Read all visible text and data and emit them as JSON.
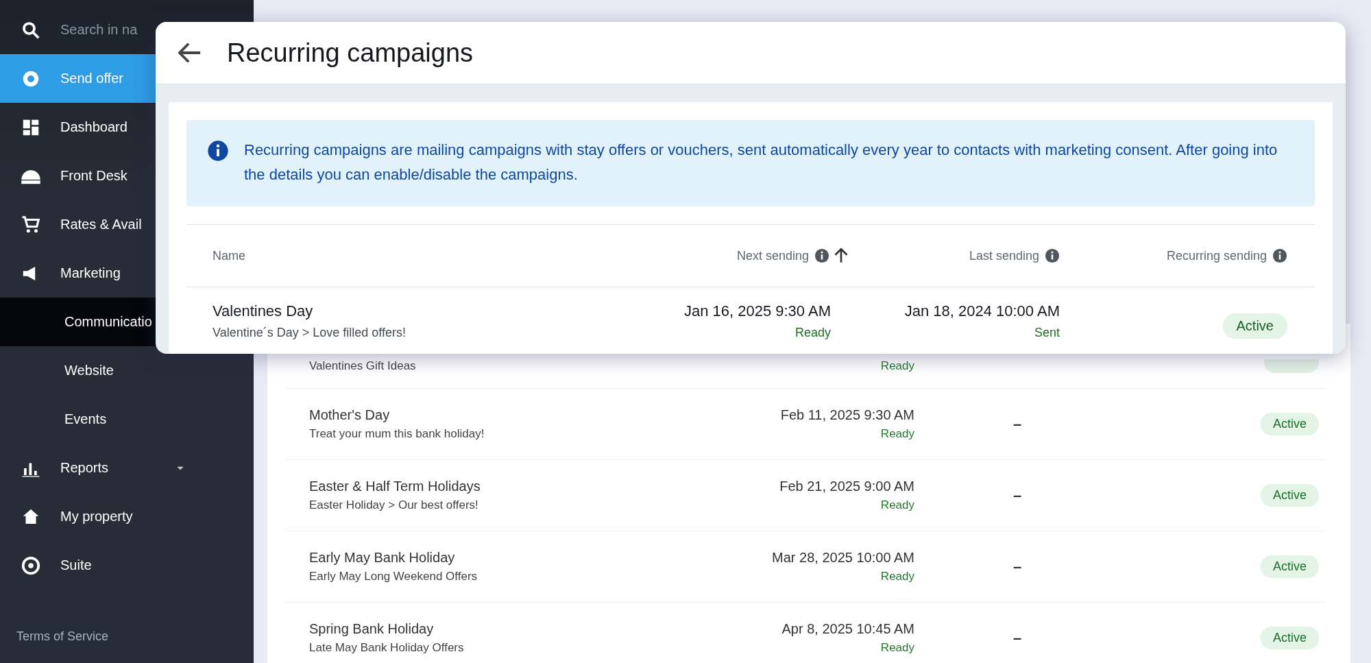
{
  "sidebar": {
    "search": {
      "placeholder": "Search in na"
    },
    "items": [
      {
        "kind": "action",
        "label": "Send offer",
        "selected": false
      },
      {
        "kind": "item",
        "label": "Dashboard",
        "selected": false
      },
      {
        "kind": "item",
        "label": "Front Desk",
        "selected": false
      },
      {
        "kind": "item",
        "label": "Rates & Avail",
        "selected": false
      },
      {
        "kind": "item",
        "label": "Marketing",
        "selected": false,
        "children": [
          {
            "kind": "subitem",
            "label": "Communicatio",
            "selected": true
          },
          {
            "kind": "subitem",
            "label": "Website",
            "selected": false
          },
          {
            "kind": "subitem",
            "label": "Events",
            "selected": false
          }
        ]
      },
      {
        "kind": "item",
        "label": "Reports",
        "selected": false,
        "expanded": false
      },
      {
        "kind": "item",
        "label": "My property",
        "selected": false
      },
      {
        "kind": "item",
        "label": "Suite",
        "selected": false
      }
    ],
    "footer": "Terms of Service"
  },
  "background_table": {
    "rows": [
      {
        "subtitle": "Valentines Gift Ideas",
        "next_status": "Ready"
      },
      {
        "name": "Mother's Day",
        "subtitle": "Treat your mum this bank holiday!",
        "next": "Feb 11, 2025 9:30 AM",
        "next_status": "Ready",
        "last": "–",
        "recurring": "Active"
      },
      {
        "name": "Easter & Half Term Holidays",
        "subtitle": "Easter Holiday > Our best offers!",
        "next": "Feb 21, 2025 9:00 AM",
        "next_status": "Ready",
        "last": "–",
        "recurring": "Active"
      },
      {
        "name": "Early May Bank Holiday",
        "subtitle": "Early May Long Weekend Offers",
        "next": "Mar 28, 2025 10:00 AM",
        "next_status": "Ready",
        "last": "–",
        "recurring": "Active"
      },
      {
        "name": "Spring Bank Holiday",
        "subtitle": "Late May Bank Holiday Offers",
        "next": "Apr 8, 2025 10:45 AM",
        "next_status": "Ready",
        "last": "–",
        "recurring": "Active"
      }
    ]
  },
  "dialog": {
    "title": "Recurring campaigns",
    "info": "Recurring campaigns are mailing campaigns with stay offers or vouchers, sent automatically every year to contacts with marketing consent. After going into the details you can enable/disable the campaigns.",
    "columns": [
      {
        "label": "Name",
        "info": false,
        "sorted": false
      },
      {
        "label": "Next sending",
        "info": true,
        "sorted": true
      },
      {
        "label": "Last sending",
        "info": true,
        "sorted": false
      },
      {
        "label": "Recurring sending",
        "info": true,
        "sorted": false
      }
    ],
    "rows": [
      {
        "name": "Valentines Day",
        "subtitle": "Valentine´s Day > Love filled offers!",
        "next": "Jan 16, 2025 9:30 AM",
        "next_status": "Ready",
        "last": "Jan 18, 2024 10:00 AM",
        "last_status": "Sent",
        "recurring": "Active"
      }
    ]
  }
}
